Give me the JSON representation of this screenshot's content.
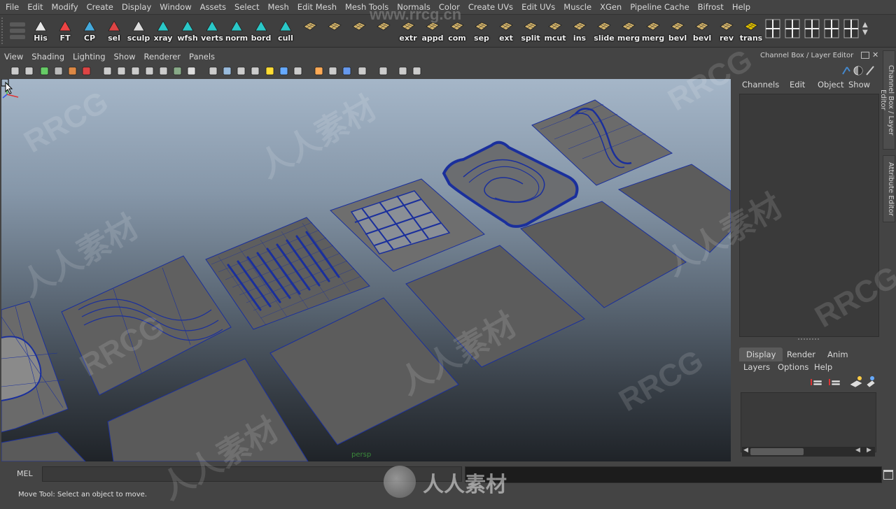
{
  "main_menu": [
    "File",
    "Edit",
    "Modify",
    "Create",
    "Display",
    "Window",
    "Assets",
    "Select",
    "Mesh",
    "Edit Mesh",
    "Mesh Tools",
    "Normals",
    "Color",
    "Create UVs",
    "Edit UVs",
    "Muscle",
    "XGen",
    "Pipeline Cache",
    "Bifrost",
    "Help"
  ],
  "shelf": [
    {
      "label": "His",
      "icon": "history-icon"
    },
    {
      "label": "FT",
      "icon": "freeze-transform-icon"
    },
    {
      "label": "CP",
      "icon": "center-pivot-icon"
    },
    {
      "label": "sel",
      "icon": "select-icon"
    },
    {
      "label": "sculp",
      "icon": "sculpt-icon"
    },
    {
      "label": "xray",
      "icon": "xray-icon"
    },
    {
      "label": "wfsh",
      "icon": "wireframe-shaded-icon"
    },
    {
      "label": "verts",
      "icon": "vertices-icon"
    },
    {
      "label": "norm",
      "icon": "normals-icon"
    },
    {
      "label": "bord",
      "icon": "border-edges-icon"
    },
    {
      "label": "cull",
      "icon": "backface-cull-icon"
    },
    {
      "label": "",
      "icon": "plane-icon"
    },
    {
      "label": "",
      "icon": "cube-icon"
    },
    {
      "label": "",
      "icon": "sphere-icon"
    },
    {
      "label": "",
      "icon": "cylinder-icon"
    },
    {
      "label": "extr",
      "icon": "extrude-icon"
    },
    {
      "label": "appd",
      "icon": "append-polygon-icon"
    },
    {
      "label": "com",
      "icon": "combine-icon"
    },
    {
      "label": "sep",
      "icon": "separate-icon"
    },
    {
      "label": "ext",
      "icon": "extract-icon"
    },
    {
      "label": "split",
      "icon": "split-polygon-icon"
    },
    {
      "label": "mcut",
      "icon": "multi-cut-icon"
    },
    {
      "label": "ins",
      "icon": "insert-edge-loop-icon"
    },
    {
      "label": "slide",
      "icon": "slide-edge-icon"
    },
    {
      "label": "merg",
      "icon": "merge-icon"
    },
    {
      "label": "merg",
      "icon": "merge-to-center-icon"
    },
    {
      "label": "bevl",
      "icon": "bevel-icon"
    },
    {
      "label": "bevl",
      "icon": "bevel-edge-icon"
    },
    {
      "label": "rev",
      "icon": "reverse-normals-icon"
    },
    {
      "label": "trans",
      "icon": "transfer-icon"
    }
  ],
  "panel_menu": [
    "View",
    "Shading",
    "Lighting",
    "Show",
    "Renderer",
    "Panels"
  ],
  "viewport": {
    "camera": "persp"
  },
  "channel_box": {
    "title": "Channel Box / Layer Editor",
    "menu": [
      "Channels",
      "Edit",
      "Object",
      "Show"
    ]
  },
  "layer_editor": {
    "tabs": [
      "Display",
      "Render",
      "Anim"
    ],
    "active_tab": "Display",
    "menu": [
      "Layers",
      "Options",
      "Help"
    ]
  },
  "side_tabs": [
    "Channel Box / Layer Editor",
    "Attribute Editor"
  ],
  "command_line": {
    "label": "MEL",
    "value": ""
  },
  "help_line": "Move Tool: Select an object to move.",
  "watermarks": {
    "url": "www.rrcg.cn",
    "brand": "RRCG",
    "cn_text": "人人素材"
  },
  "colors": {
    "accent": "#1a2f9c",
    "viewport_top": "#a5b6c8",
    "viewport_bottom": "#1f2328"
  }
}
